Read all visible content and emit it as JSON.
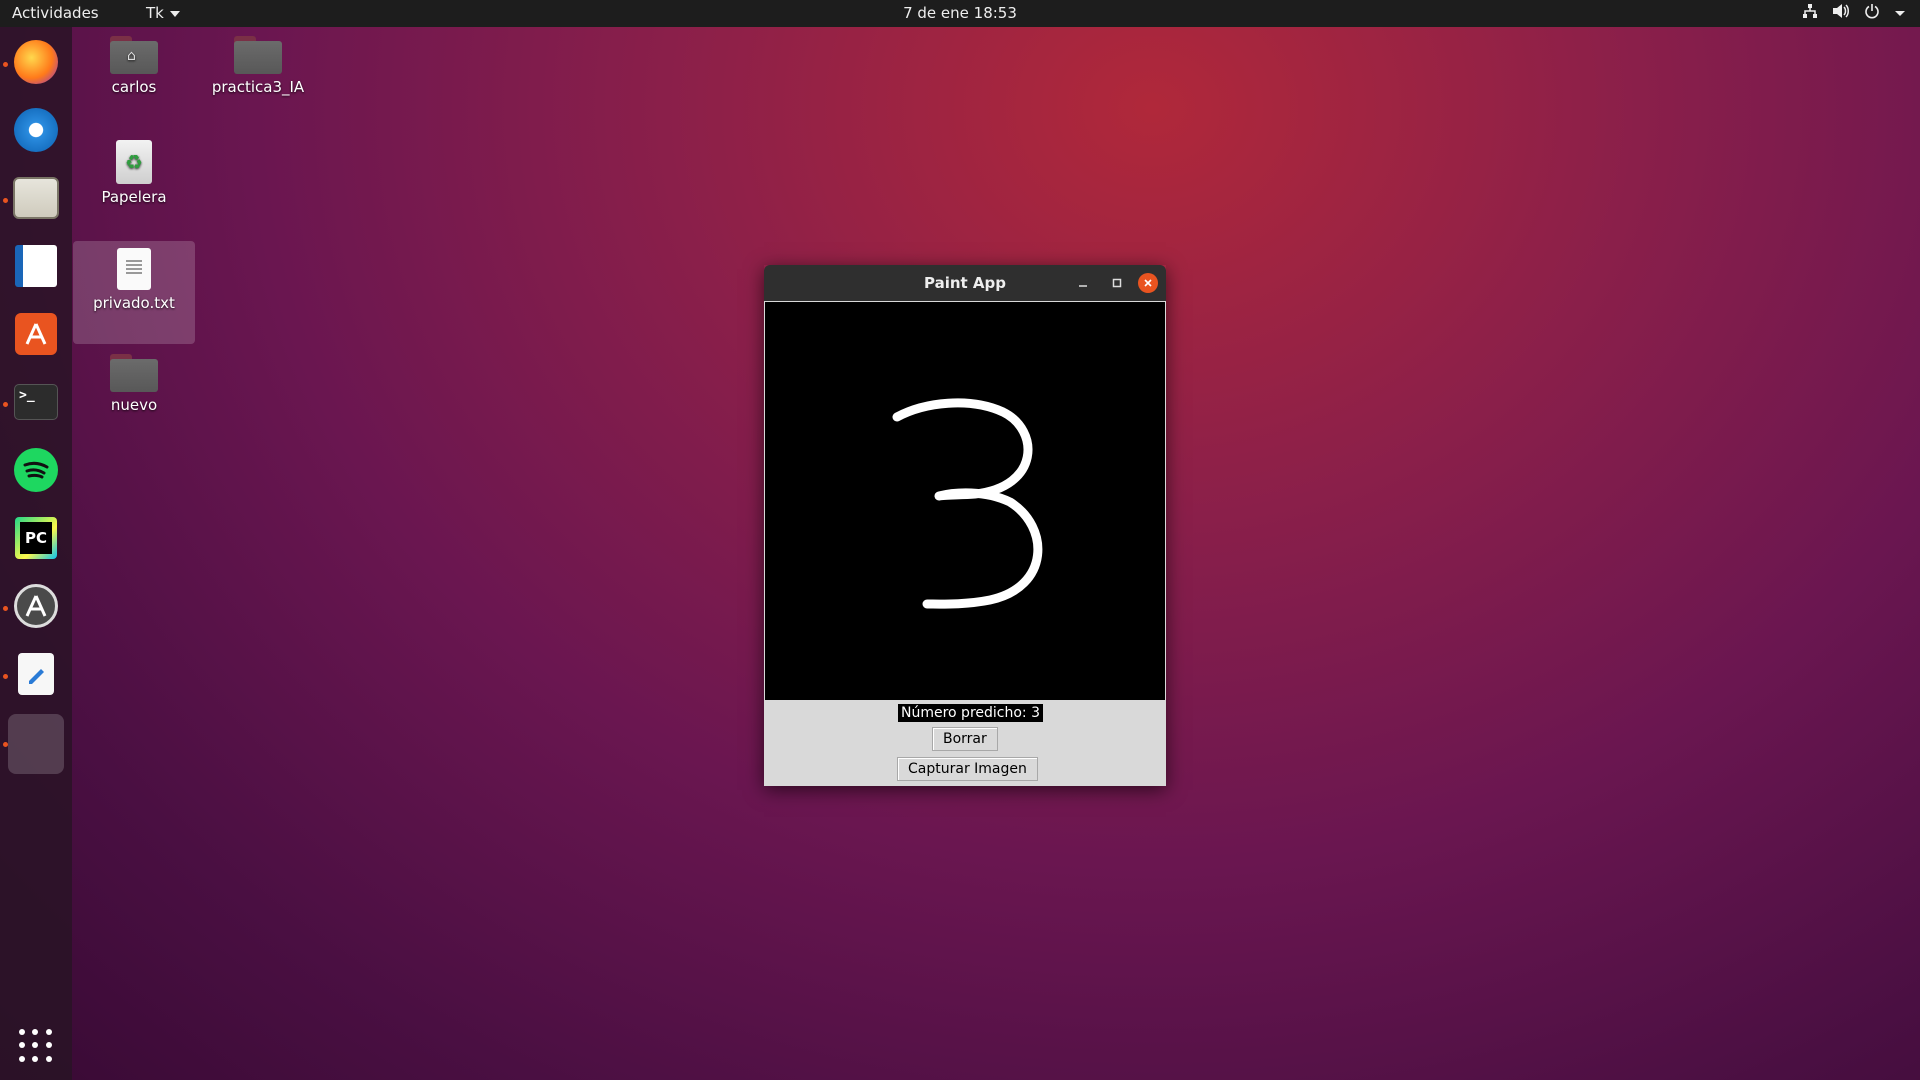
{
  "topbar": {
    "activities": "Actividades",
    "app_menu": "Tk",
    "clock": "7 de ene  18:53",
    "tray_icons": [
      "network-icon",
      "volume-icon",
      "power-icon",
      "chevron-down-icon"
    ]
  },
  "dock": {
    "items": [
      {
        "name": "firefox",
        "icon": "firefox-icon",
        "running": true
      },
      {
        "name": "thunderbird",
        "icon": "thunderbird-icon",
        "running": false
      },
      {
        "name": "files",
        "icon": "files-icon",
        "running": true
      },
      {
        "name": "libreoffice-writer",
        "icon": "writer-icon",
        "running": false
      },
      {
        "name": "ubuntu-software",
        "icon": "software-icon",
        "running": false
      },
      {
        "name": "terminal",
        "icon": "terminal-icon",
        "running": true
      },
      {
        "name": "spotify",
        "icon": "spotify-icon",
        "running": false
      },
      {
        "name": "pycharm",
        "icon": "pycharm-icon",
        "running": false
      },
      {
        "name": "software-updater",
        "icon": "updater-icon",
        "running": true
      },
      {
        "name": "text-editor",
        "icon": "text-editor-icon",
        "running": true
      },
      {
        "name": "tk-app",
        "icon": "tk-app-icon",
        "running": true
      }
    ],
    "terminal_glyph": ">_",
    "pycharm_glyph": "PC"
  },
  "desktop": {
    "icons": [
      {
        "label": "carlos",
        "type": "home-folder"
      },
      {
        "label": "practica3_IA",
        "type": "folder"
      },
      {
        "label": "Papelera",
        "type": "trash"
      },
      {
        "label": "privado.txt",
        "type": "text-file"
      },
      {
        "label": "nuevo",
        "type": "folder"
      }
    ]
  },
  "window": {
    "title": "Paint App",
    "prediction_label": "Número predicho: 3",
    "clear_button": "Borrar",
    "capture_button": "Capturar Imagen"
  },
  "colors": {
    "accent": "#e95420",
    "topbar": "#1d1d1d",
    "canvas": "#000000",
    "tk_bg": "#d9d9d9"
  }
}
